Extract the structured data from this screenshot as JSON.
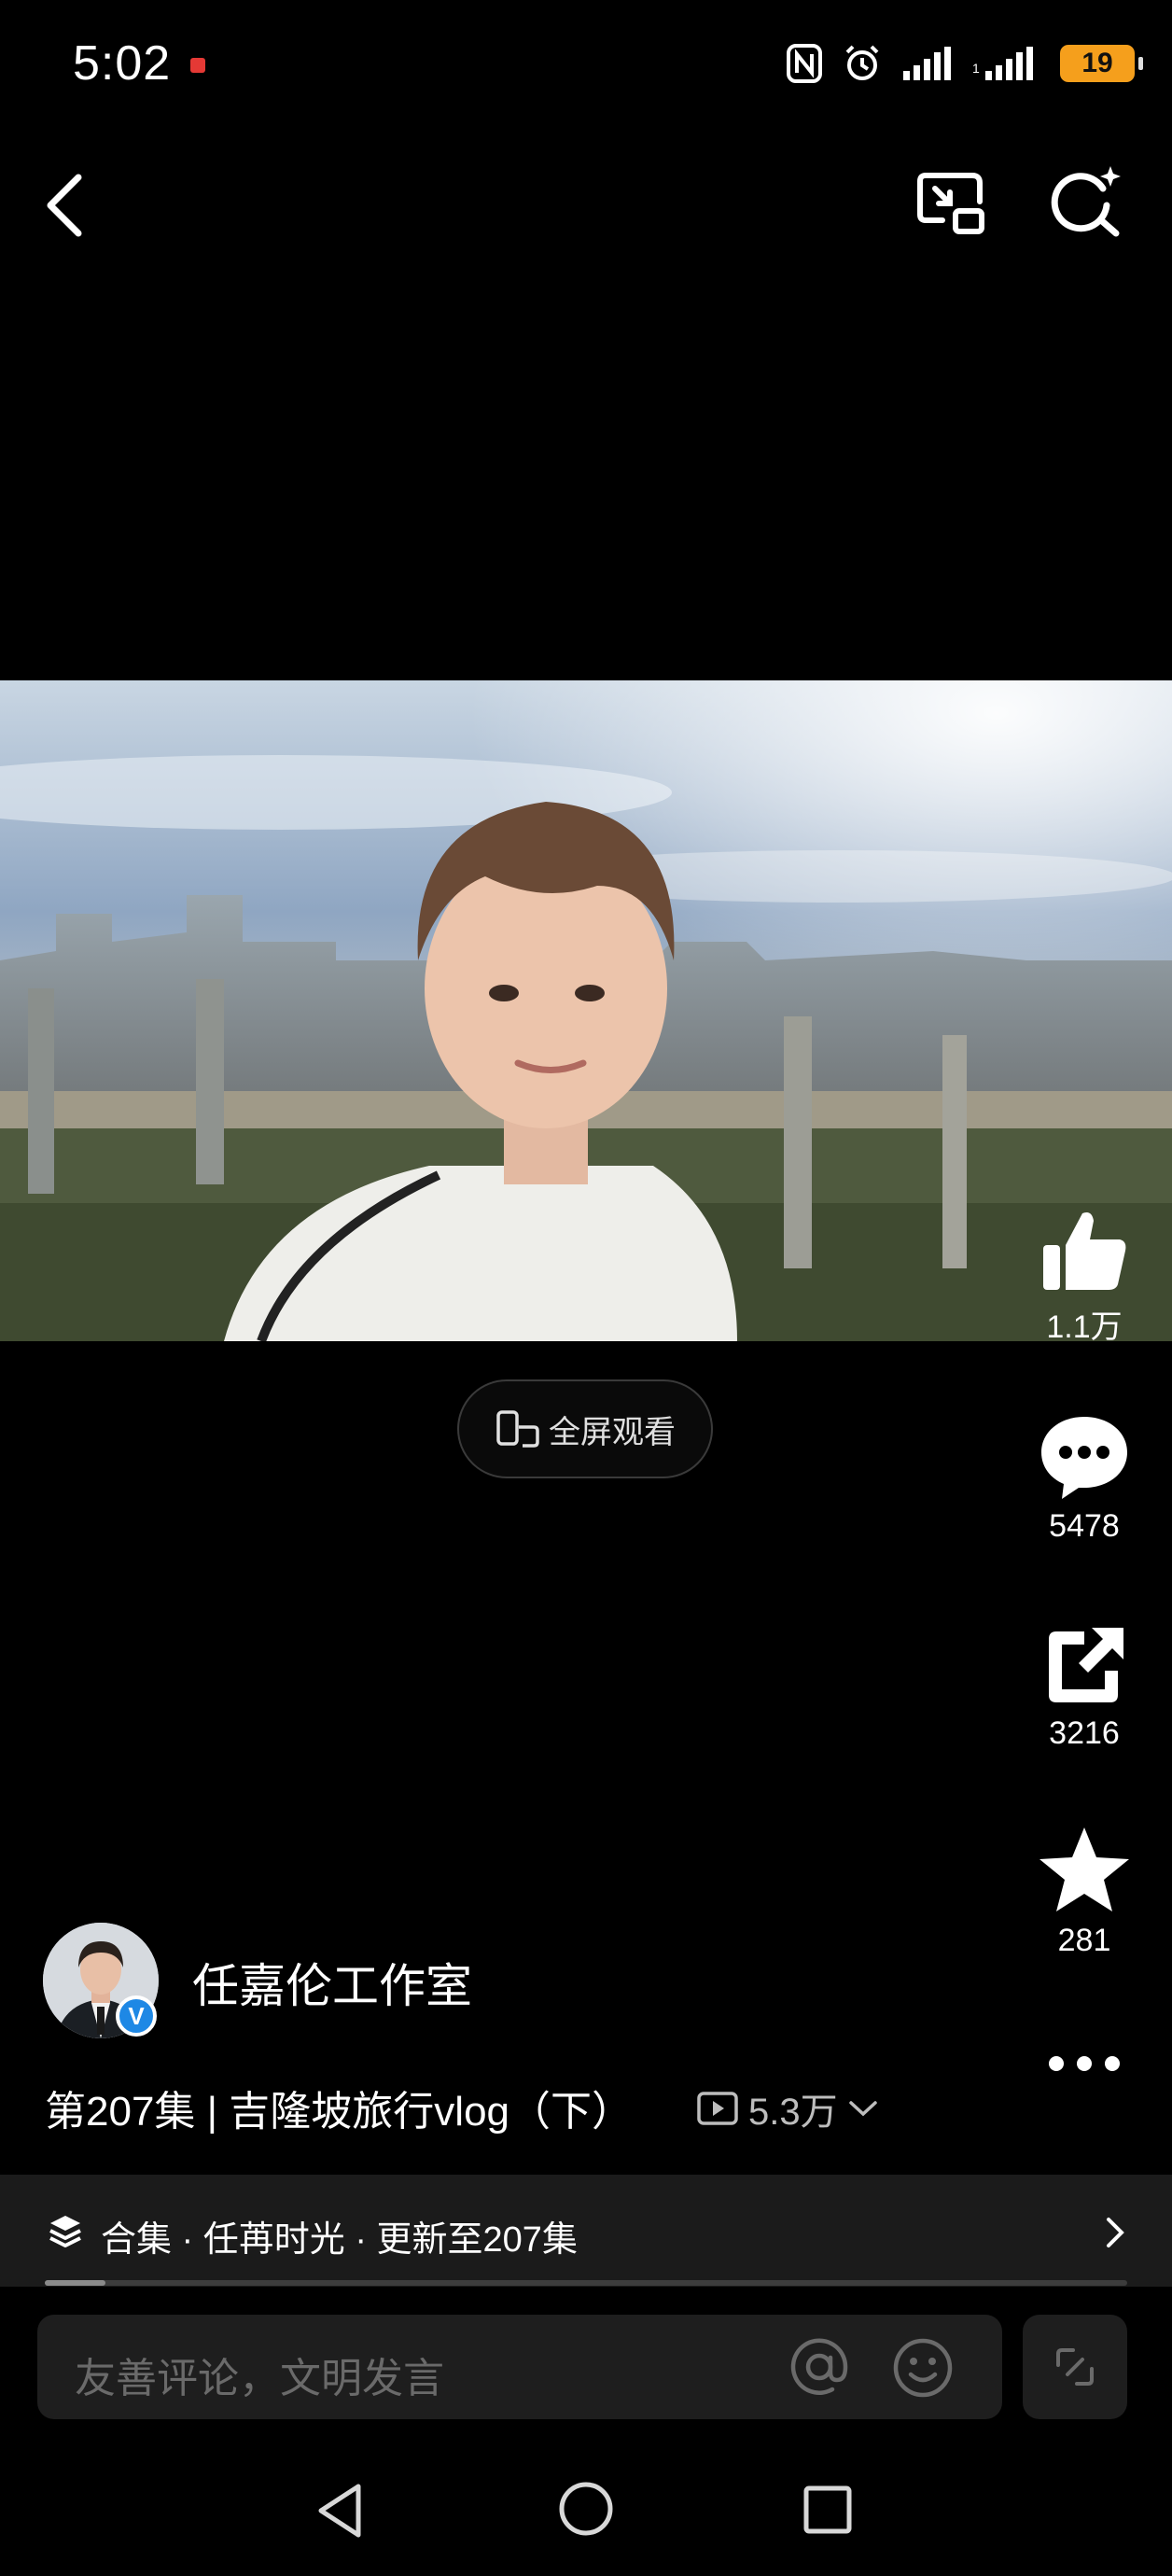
{
  "status_bar": {
    "time": "5:02",
    "battery_level": "19",
    "icons": [
      "nfc-icon",
      "alarm-icon",
      "signal-icon",
      "signal-icon"
    ]
  },
  "top_nav": {
    "back_icon": "chevron-left-icon",
    "pip_icon": "picture-in-picture-icon",
    "search_icon": "search-sparkle-icon"
  },
  "video": {
    "fullscreen_label": "全屏观看"
  },
  "actions": {
    "like_count": "1.1万",
    "comment_count": "5478",
    "share_count": "3216",
    "favorite_count": "281"
  },
  "author": {
    "name": "任嘉伦工作室",
    "verified_mark": "V"
  },
  "title": {
    "text": "第207集 | 吉隆坡旅行vlog（下）",
    "views": "5.3万"
  },
  "collection": {
    "label": "合集 · 任苒时光 · 更新至207集",
    "progress": 0.056
  },
  "comment": {
    "placeholder": "友善评论，文明发言"
  },
  "colors": {
    "background": "#000000",
    "battery": "#f59f1c",
    "verified": "#1e88e5",
    "recording_dot": "#e53935"
  }
}
